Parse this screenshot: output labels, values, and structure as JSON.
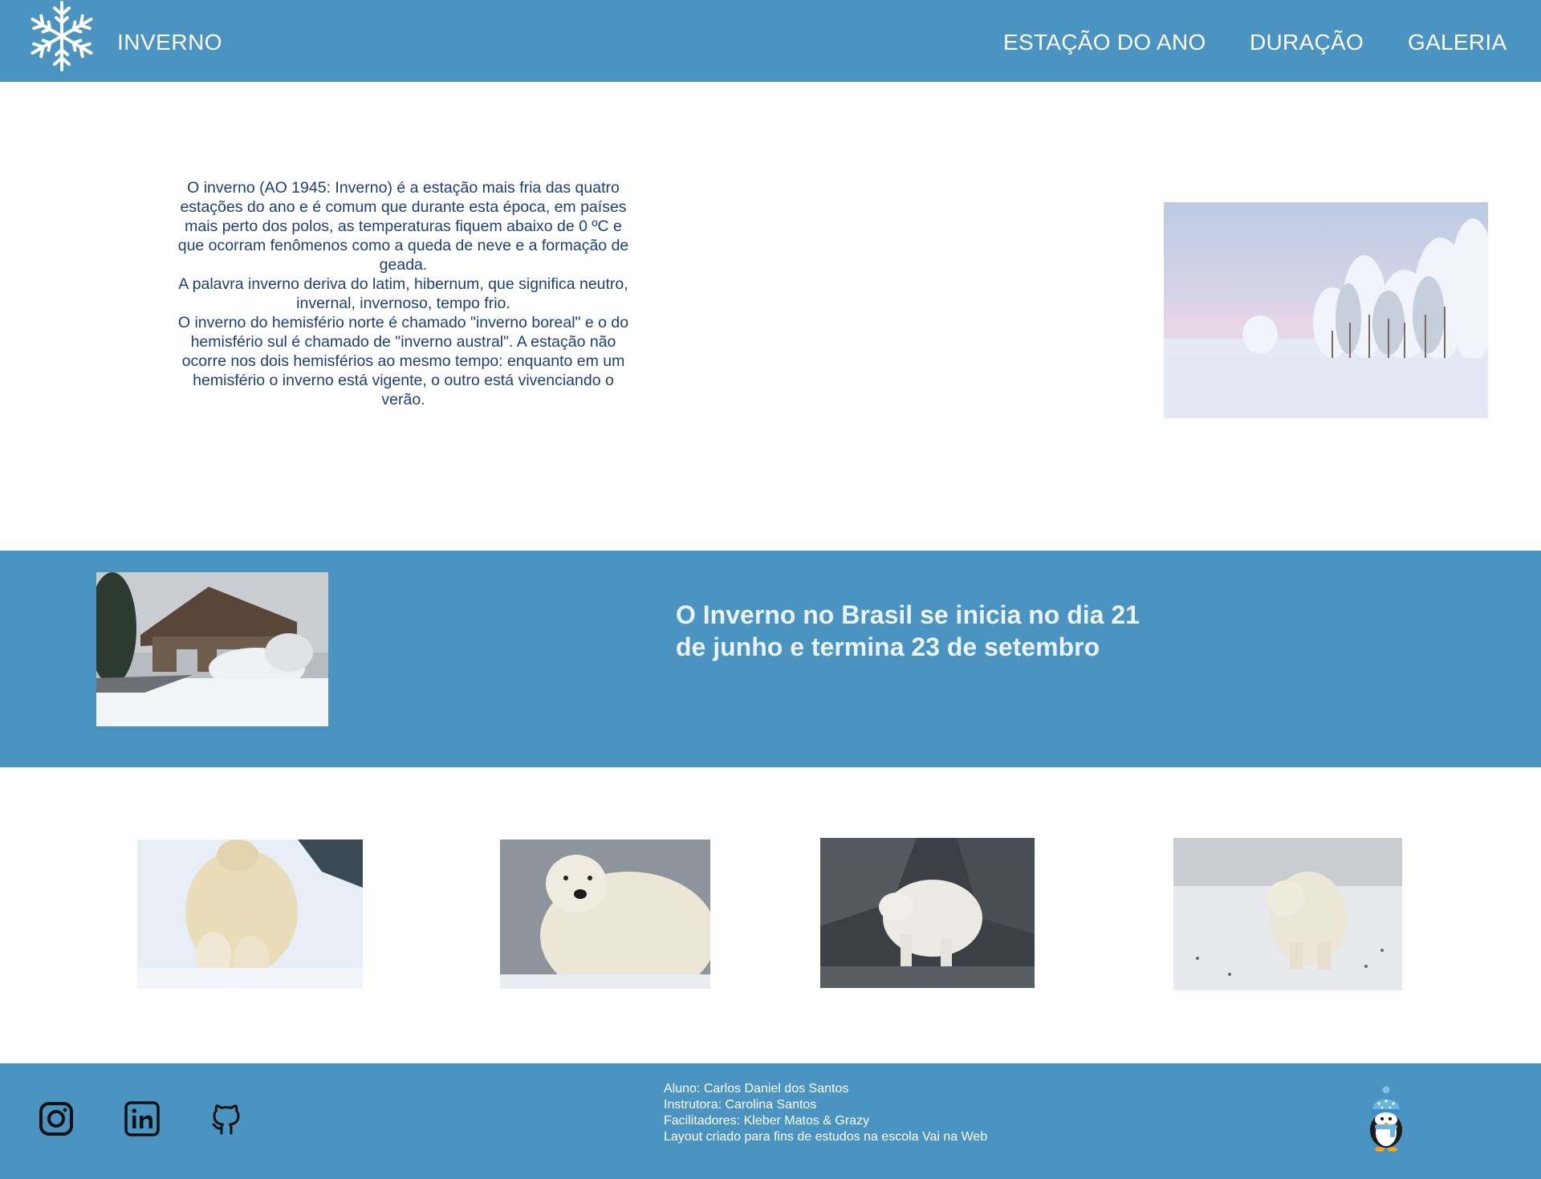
{
  "header": {
    "logo_icon": "snowflake-icon",
    "brand": "INVERNO",
    "nav": [
      "ESTAÇÃO DO ANO",
      "DURAÇÃO",
      "GALERIA"
    ]
  },
  "intro": {
    "paragraphs": [
      "O inverno (AO 1945: Inverno) é a estação mais fria das quatro estações do ano e é comum que durante esta época, em países mais perto dos polos, as temperaturas fiquem abaixo de 0 ºC e que ocorram fenômenos como a queda de neve e a formação de geada.",
      "A palavra inverno deriva do latim, hibernum, que significa neutro, invernal, invernoso, tempo frio.",
      "O inverno do hemisfério norte é chamado \"inverno boreal\" e o do hemisfério sul é chamado de \"inverno austral\". A estação não ocorre nos dois hemisférios ao mesmo tempo: enquanto em um hemisfério o inverno está vigente, o outro está vivenciando o verão."
    ]
  },
  "band": {
    "headline_lines": [
      "O Inverno no Brasil se inicia no dia 21",
      "de junho e termina 23 de setembro"
    ]
  },
  "footer": {
    "social_icons": [
      "instagram-icon",
      "linkedin-icon",
      "github-icon"
    ],
    "credits": [
      "Aluno: Carlos Daniel dos Santos",
      "Instrutora: Carolina Santos",
      "Facilitadores: Kleber Matos & Grazy",
      "Layout criado para fins de estudos na escola Vai na Web"
    ],
    "mascot_icon": "penguin-icon"
  },
  "colors": {
    "primary": "#4b93c1",
    "body_text": "#1e3f73",
    "white": "#ffffff"
  }
}
